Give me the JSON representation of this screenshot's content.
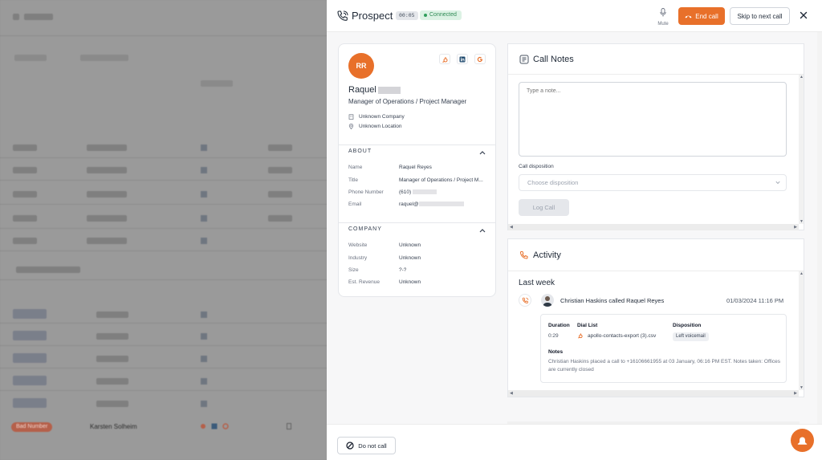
{
  "header": {
    "title": "Prospect",
    "timer": "00:05",
    "status": "Connected",
    "mute_label": "Mute",
    "end_call_label": "End call",
    "skip_label": "Skip to next call"
  },
  "contact": {
    "initials": "RR",
    "first_name": "Raquel",
    "title": "Manager of Operations / Project Manager",
    "company": "Unknown Company",
    "location": "Unknown Location",
    "social_icons": [
      "hubspot-icon",
      "linkedin-icon",
      "google-icon"
    ],
    "about": {
      "heading": "ABOUT",
      "rows": [
        {
          "label": "Name",
          "value": "Raquel Reyes"
        },
        {
          "label": "Title",
          "value": "Manager of Operations / Project M..."
        },
        {
          "label": "Phone Number",
          "value": "(610)"
        },
        {
          "label": "Email",
          "value": "raquel@"
        }
      ]
    },
    "company_section": {
      "heading": "COMPANY",
      "rows": [
        {
          "label": "Website",
          "value": "Unknown"
        },
        {
          "label": "Industry",
          "value": "Unknown"
        },
        {
          "label": "Size",
          "value": "?-?"
        },
        {
          "label": "Est. Revenue",
          "value": "Unknown"
        }
      ]
    }
  },
  "call_notes": {
    "title": "Call Notes",
    "placeholder": "Type a note...",
    "disposition_label": "Call disposition",
    "disposition_placeholder": "Choose disposition",
    "log_call_label": "Log Call"
  },
  "activity": {
    "title": "Activity",
    "group_label": "Last week",
    "item": {
      "summary": "Christian Haskins called Raquel Reyes",
      "timestamp": "01/03/2024 11:16 PM",
      "duration_label": "Duration",
      "duration_value": "0:29",
      "dial_list_label": "Dial List",
      "dial_list_value": "apollo-contacts-export (3).csv",
      "disposition_label": "Disposition",
      "disposition_value": "Left voicemail",
      "notes_label": "Notes",
      "notes_value": "Christian Haskins placed a call to +16106661955 at 03 January, 06:16 PM EST. Notes taken: Offices are currently closed"
    }
  },
  "footer": {
    "do_not_call_label": "Do not call"
  },
  "background": {
    "badge": "Bad Number",
    "name": "Karsten Solheim"
  },
  "colors": {
    "accent": "#e8702a",
    "connected": "#2f8a55",
    "connected_bg": "#dcf2e4"
  }
}
